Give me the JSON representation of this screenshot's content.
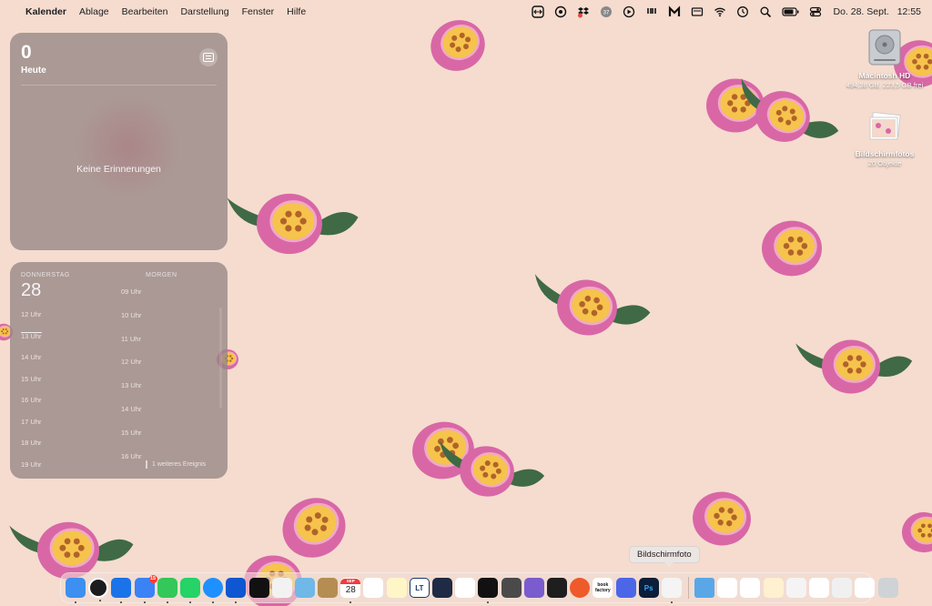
{
  "menubar": {
    "apple_glyph": "",
    "app_name": "Kalender",
    "menus": [
      "Ablage",
      "Bearbeiten",
      "Darstellung",
      "Fenster",
      "Hilfe"
    ],
    "status_icons": [
      "teamviewer-icon",
      "vpn-icon",
      "dropbox-icon",
      "istat-icon",
      "play-icon",
      "airbuddy-icon",
      "malwarebytes-icon",
      "screen-icon",
      "wifi-icon",
      "time-machine-icon",
      "spotlight-icon",
      "battery-icon",
      "control-center-icon"
    ],
    "date": "Do. 28. Sept.",
    "time": "12:55"
  },
  "reminders_widget": {
    "count": "0",
    "label": "Heute",
    "empty_text": "Keine Erinnerungen"
  },
  "calendar_widget": {
    "weekday": "DONNERSTAG",
    "day": "28",
    "tomorrow": "MORGEN",
    "today_hours": [
      "12 Uhr",
      "13 Uhr",
      "14 Uhr",
      "15 Uhr",
      "16 Uhr",
      "17 Uhr",
      "18 Uhr",
      "19 Uhr"
    ],
    "tomorrow_hours": [
      "09 Uhr",
      "10 Uhr",
      "11 Uhr",
      "12 Uhr",
      "13 Uhr",
      "14 Uhr",
      "15 Uhr",
      "16 Uhr"
    ],
    "more_events": "1 weiteres Ereignis"
  },
  "desktop": {
    "hd": {
      "name": "Macintosh HD",
      "sub": "494,38 GB, 223,5 GB frei"
    },
    "screenshots": {
      "name": "Bildschirmfotos",
      "sub": "20 Objekte"
    }
  },
  "tooltip": "Bildschirmfoto",
  "dock": {
    "calendar_month": "SEP",
    "calendar_day": "28",
    "mail_badge": "15",
    "bookfactory_label": "book factory",
    "lt_label": "LT",
    "ps_label": "Ps",
    "apps": [
      {
        "name": "finder",
        "color": "#3d8ff0",
        "running": true
      },
      {
        "name": "clock",
        "color": "#1c1c1e",
        "running": true
      },
      {
        "name": "1password",
        "color": "#1a73e8",
        "running": true
      },
      {
        "name": "mail",
        "color": "#3b82f6",
        "running": true
      },
      {
        "name": "messages",
        "color": "#34c759",
        "running": true
      },
      {
        "name": "whatsapp",
        "color": "#25d366",
        "running": true
      },
      {
        "name": "safari",
        "color": "#1e90ff",
        "running": true
      },
      {
        "name": "teamviewer",
        "color": "#0e57d0",
        "running": true
      },
      {
        "name": "notchmeister",
        "color": "#111111",
        "running": false
      },
      {
        "name": "pages",
        "color": "#f2f2f2",
        "running": false
      },
      {
        "name": "layers",
        "color": "#6fb8e8",
        "running": false
      },
      {
        "name": "notebook",
        "color": "#b58d52",
        "running": false
      },
      {
        "name": "calendar",
        "color": "#ffffff",
        "running": true
      },
      {
        "name": "reminders",
        "color": "#ffffff",
        "running": false
      },
      {
        "name": "notes",
        "color": "#fff6c7",
        "running": false
      },
      {
        "name": "languagetool",
        "color": "#ffffff",
        "running": false
      },
      {
        "name": "vectorize",
        "color": "#1f2a44",
        "running": false
      },
      {
        "name": "photos",
        "color": "#ffffff",
        "running": false
      },
      {
        "name": "tidal",
        "color": "#111111",
        "running": true
      },
      {
        "name": "sublime",
        "color": "#4a4a4a",
        "running": false
      },
      {
        "name": "cube",
        "color": "#7a5ccf",
        "running": false
      },
      {
        "name": "terminal",
        "color": "#1e1e1e",
        "running": false
      },
      {
        "name": "compass",
        "color": "#ef5a2b",
        "running": false
      },
      {
        "name": "bookfactory",
        "color": "#ffffff",
        "running": false
      },
      {
        "name": "flower",
        "color": "#4b67e8",
        "running": false
      },
      {
        "name": "photoshop",
        "color": "#0b1e3a",
        "running": false
      },
      {
        "name": "screenshot",
        "color": "#f4f4f4",
        "running": true
      }
    ],
    "folders": [
      {
        "name": "downloads-folder",
        "color": "#5aa7e8"
      },
      {
        "name": "stack-1",
        "color": "#ffffff"
      },
      {
        "name": "stack-2",
        "color": "#ffffff"
      },
      {
        "name": "stack-3",
        "color": "#fff0d0"
      },
      {
        "name": "stack-4",
        "color": "#f4f4f4"
      },
      {
        "name": "stack-5",
        "color": "#ffffff"
      },
      {
        "name": "stack-6",
        "color": "#f0f0f0"
      },
      {
        "name": "stack-7",
        "color": "#ffffff"
      },
      {
        "name": "trash",
        "color": "#cfd3d6"
      }
    ]
  },
  "colors": {
    "wallpaper": "#f5dccf",
    "fruit_rind": "#d967a6",
    "fruit_flesh": "#f6c34c",
    "fruit_seeds": "#b0632a",
    "leaf": "#3f6a45"
  }
}
